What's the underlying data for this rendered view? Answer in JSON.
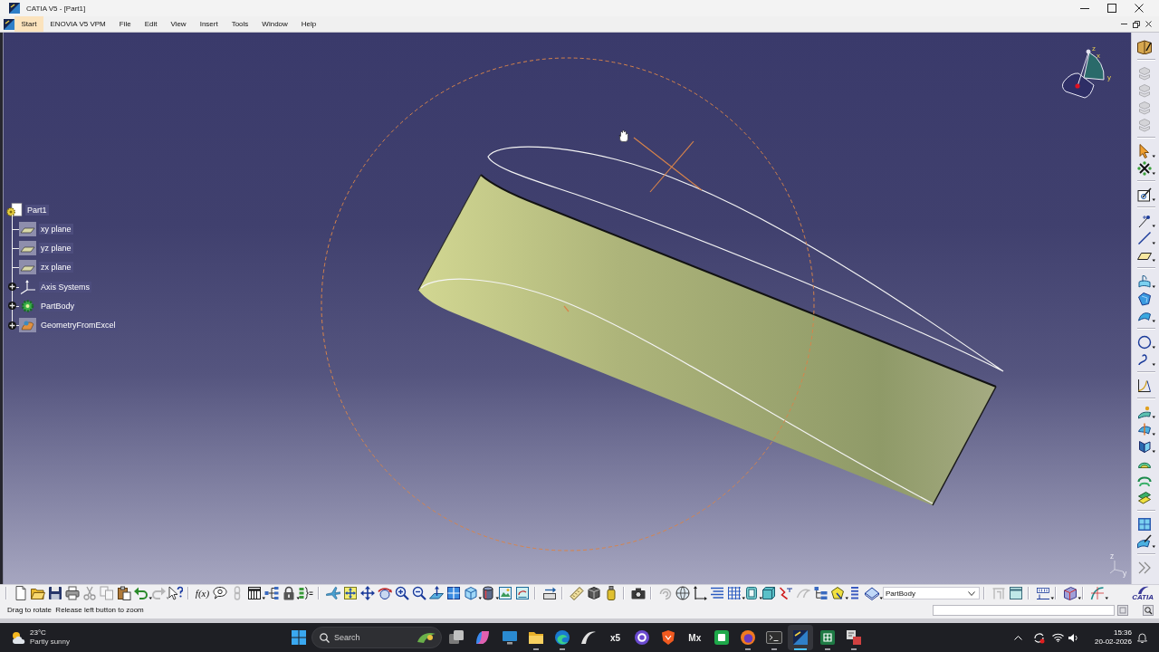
{
  "window": {
    "title": "CATIA V5 - [Part1]"
  },
  "menu": [
    {
      "label": "Start",
      "selected": true
    },
    {
      "label": "ENOVIA V5 VPM",
      "selected": false
    },
    {
      "label": "File",
      "selected": false
    },
    {
      "label": "Edit",
      "selected": false
    },
    {
      "label": "View",
      "selected": false
    },
    {
      "label": "Insert",
      "selected": false
    },
    {
      "label": "Tools",
      "selected": false
    },
    {
      "label": "Window",
      "selected": false
    },
    {
      "label": "Help",
      "selected": false
    }
  ],
  "tree": {
    "label": "Part1",
    "kind": "part",
    "children": [
      {
        "label": "xy plane",
        "kind": "plane",
        "expandable": false
      },
      {
        "label": "yz plane",
        "kind": "plane",
        "expandable": false
      },
      {
        "label": "zx plane",
        "kind": "plane",
        "expandable": false
      },
      {
        "label": "Axis Systems",
        "kind": "axes",
        "expandable": true
      },
      {
        "label": "PartBody",
        "kind": "body",
        "expandable": true
      },
      {
        "label": "GeometryFromExcel",
        "kind": "geometry",
        "expandable": true
      }
    ]
  },
  "scene": {
    "compass": {
      "labels": [
        "z",
        "x",
        "y"
      ]
    },
    "axis_triad": {
      "labels": [
        "z",
        "y"
      ]
    }
  },
  "side_toolbar": {
    "groups": [
      [
        {
          "kind": "workbench",
          "disabled": false
        }
      ],
      [
        {
          "kind": "layers",
          "disabled": true
        },
        {
          "kind": "layers",
          "disabled": true
        },
        {
          "kind": "layers",
          "disabled": true
        },
        {
          "kind": "layers",
          "disabled": true
        }
      ],
      [
        {
          "kind": "select",
          "disabled": false
        },
        {
          "kind": "snap",
          "disabled": false
        }
      ],
      [
        {
          "kind": "sketch",
          "disabled": false
        }
      ],
      [
        {
          "kind": "point",
          "disabled": false
        },
        {
          "kind": "line",
          "disabled": false
        },
        {
          "kind": "plane",
          "disabled": false
        }
      ],
      [
        {
          "kind": "extrude",
          "disabled": false
        },
        {
          "kind": "fill",
          "disabled": false
        },
        {
          "kind": "sweep",
          "disabled": false
        }
      ],
      [
        {
          "kind": "circle",
          "disabled": false
        },
        {
          "kind": "spline",
          "disabled": false
        }
      ],
      [
        {
          "kind": "law",
          "disabled": false
        }
      ],
      [
        {
          "kind": "surfpoint",
          "disabled": false
        },
        {
          "kind": "split",
          "disabled": false
        },
        {
          "kind": "trim",
          "disabled": false
        },
        {
          "kind": "loft",
          "disabled": false
        },
        {
          "kind": "offset",
          "disabled": false
        },
        {
          "kind": "sheets",
          "disabled": false
        }
      ],
      [
        {
          "kind": "quad",
          "disabled": false
        },
        {
          "kind": "surfpen",
          "disabled": false
        }
      ],
      [
        {
          "kind": "more",
          "disabled": false
        }
      ]
    ]
  },
  "bottom_toolbar": {
    "groups": [
      [
        {
          "kind": "new",
          "disabled": false
        },
        {
          "kind": "open",
          "disabled": false
        },
        {
          "kind": "save",
          "disabled": false
        },
        {
          "kind": "print",
          "disabled": false
        },
        {
          "kind": "cut",
          "disabled": true
        },
        {
          "kind": "copy",
          "disabled": true
        },
        {
          "kind": "paste",
          "disabled": false
        },
        {
          "kind": "undo",
          "disabled": false
        },
        {
          "kind": "redo",
          "disabled": true
        },
        {
          "kind": "whatsthis",
          "disabled": false
        }
      ],
      [
        {
          "kind": "formula",
          "label": "f(x)",
          "disabled": false
        },
        {
          "kind": "comment",
          "disabled": false
        },
        {
          "kind": "link",
          "disabled": true
        },
        {
          "kind": "table",
          "disabled": false
        },
        {
          "kind": "tree",
          "disabled": false
        },
        {
          "kind": "lock",
          "disabled": false
        },
        {
          "kind": "params",
          "disabled": false
        }
      ],
      [
        {
          "kind": "fly",
          "disabled": false
        },
        {
          "kind": "fitall",
          "disabled": false
        },
        {
          "kind": "pan",
          "disabled": false
        },
        {
          "kind": "rotate",
          "disabled": false
        },
        {
          "kind": "zoomin",
          "disabled": false
        },
        {
          "kind": "zoomout",
          "disabled": false
        },
        {
          "kind": "normal",
          "disabled": false
        },
        {
          "kind": "multiview",
          "disabled": false
        },
        {
          "kind": "isoview",
          "disabled": false
        },
        {
          "kind": "shading",
          "disabled": false
        },
        {
          "kind": "hideshow",
          "disabled": false
        },
        {
          "kind": "swap",
          "disabled": false
        }
      ],
      [
        {
          "kind": "transfer",
          "disabled": false
        }
      ],
      [
        {
          "kind": "ruler",
          "disabled": false
        },
        {
          "kind": "gridbox",
          "disabled": false
        },
        {
          "kind": "canister",
          "disabled": false
        }
      ],
      [
        {
          "kind": "camera",
          "disabled": false
        }
      ],
      [
        {
          "kind": "swirl",
          "disabled": true
        },
        {
          "kind": "globe",
          "disabled": false
        },
        {
          "kind": "axis",
          "disabled": false
        },
        {
          "kind": "list",
          "disabled": false
        },
        {
          "kind": "grid",
          "disabled": false
        },
        {
          "kind": "tealbox",
          "disabled": false
        },
        {
          "kind": "tealcube",
          "disabled": false
        },
        {
          "kind": "zigzag",
          "disabled": false
        },
        {
          "kind": "loop",
          "disabled": true
        },
        {
          "kind": "hierarchy",
          "disabled": false
        },
        {
          "kind": "polygon",
          "disabled": false
        },
        {
          "kind": "stack",
          "disabled": false
        },
        {
          "kind": "bodyplane",
          "disabled": false
        },
        {
          "kind": "combo",
          "value": "PartBody",
          "disabled": false
        }
      ],
      [
        {
          "kind": "frame",
          "disabled": true
        },
        {
          "kind": "windowframe",
          "disabled": false
        }
      ],
      [
        {
          "kind": "annotation",
          "disabled": false
        }
      ],
      [
        {
          "kind": "layeredbox",
          "disabled": false
        }
      ],
      [
        {
          "kind": "curveanalysis",
          "disabled": false
        }
      ]
    ],
    "logo": {
      "text": "CATIA"
    }
  },
  "status_bar": {
    "message": "Drag to rotate  Release left button to zoom"
  },
  "taskbar": {
    "weather": {
      "temperature": "23°C",
      "condition": "Partly sunny"
    },
    "search": {
      "placeholder": "Search"
    },
    "apps": [
      {
        "kind": "taskview",
        "running": false,
        "selected": false
      },
      {
        "kind": "copilot",
        "running": false,
        "selected": false
      },
      {
        "kind": "monitor",
        "running": false,
        "selected": false
      },
      {
        "kind": "folder",
        "running": true,
        "selected": false
      },
      {
        "kind": "edge",
        "running": true,
        "selected": false
      },
      {
        "kind": "swoosh",
        "running": false,
        "selected": false
      },
      {
        "kind": "tile",
        "label": "x5",
        "running": false,
        "selected": false
      },
      {
        "kind": "ring",
        "running": false,
        "selected": false
      },
      {
        "kind": "shield",
        "running": false,
        "selected": false
      },
      {
        "kind": "tile",
        "label": "Mx",
        "running": false,
        "selected": false
      },
      {
        "kind": "green",
        "running": false,
        "selected": false
      },
      {
        "kind": "firefox",
        "running": true,
        "selected": false
      },
      {
        "kind": "terminal",
        "running": true,
        "selected": false
      },
      {
        "kind": "catia",
        "running": true,
        "selected": true
      },
      {
        "kind": "excel",
        "running": true,
        "selected": false
      },
      {
        "kind": "diagram",
        "running": true,
        "selected": false
      }
    ],
    "clock": {
      "time": "15:36",
      "date": "20-02-2026"
    }
  }
}
